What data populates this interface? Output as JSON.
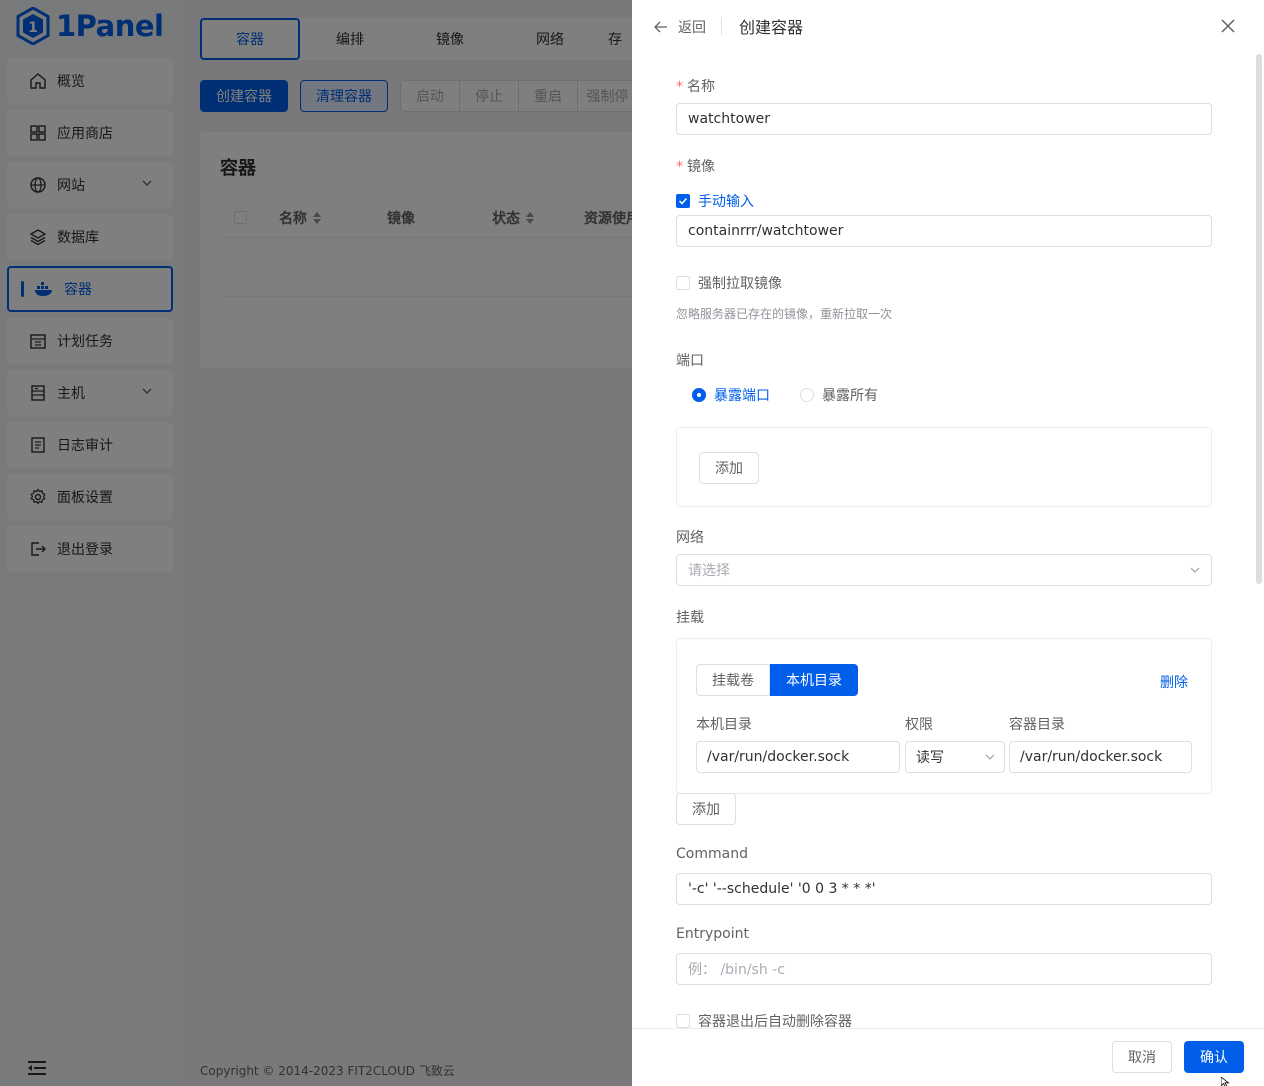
{
  "app": {
    "logo_text": "1Panel",
    "copyright": "Copyright © 2014-2023 FIT2CLOUD 飞致云"
  },
  "sidebar": {
    "items": [
      {
        "label": "概览",
        "icon": "home-icon"
      },
      {
        "label": "应用商店",
        "icon": "grid-icon"
      },
      {
        "label": "网站",
        "icon": "globe-icon",
        "expandable": true
      },
      {
        "label": "数据库",
        "icon": "layers-icon"
      },
      {
        "label": "容器",
        "icon": "docker-icon",
        "active": true
      },
      {
        "label": "计划任务",
        "icon": "calendar-icon"
      },
      {
        "label": "主机",
        "icon": "server-icon",
        "expandable": true
      },
      {
        "label": "日志审计",
        "icon": "log-icon"
      },
      {
        "label": "面板设置",
        "icon": "gear-icon"
      },
      {
        "label": "退出登录",
        "icon": "logout-icon"
      }
    ]
  },
  "tabs": [
    "容器",
    "编排",
    "镜像",
    "网络",
    "存"
  ],
  "toolbar": {
    "create": "创建容器",
    "prune": "清理容器",
    "group": [
      "启动",
      "停止",
      "重启",
      "强制停"
    ]
  },
  "table": {
    "title": "容器",
    "columns": [
      "名称",
      "镜像",
      "状态",
      "资源使用"
    ]
  },
  "drawer": {
    "back": "返回",
    "title": "创建容器",
    "name_label": "名称",
    "name_value": "watchtower",
    "image_label": "镜像",
    "manual_input": "手动输入",
    "image_value": "containrrr/watchtower",
    "force_pull": "强制拉取镜像",
    "force_pull_hint": "忽略服务器已存在的镜像，重新拉取一次",
    "port_label": "端口",
    "port_options": [
      "暴露端口",
      "暴露所有"
    ],
    "add": "添加",
    "network_label": "网络",
    "network_placeholder": "请选择",
    "mount_label": "挂载",
    "mount_tabs": [
      "挂载卷",
      "本机目录"
    ],
    "delete": "删除",
    "mount_cols": [
      "本机目录",
      "权限",
      "容器目录"
    ],
    "mount_row": {
      "host": "/var/run/docker.sock",
      "perm": "读写",
      "container": "/var/run/docker.sock"
    },
    "command_label": "Command",
    "command_value": "'-c' '--schedule' '0 0 3 * * *'",
    "entrypoint_label": "Entrypoint",
    "entrypoint_placeholder": "例： /bin/sh -c",
    "auto_remove": "容器退出后自动删除容器",
    "cancel": "取消",
    "confirm": "确认"
  },
  "colors": {
    "primary": "#005eeb",
    "required": "#f56c6c"
  }
}
